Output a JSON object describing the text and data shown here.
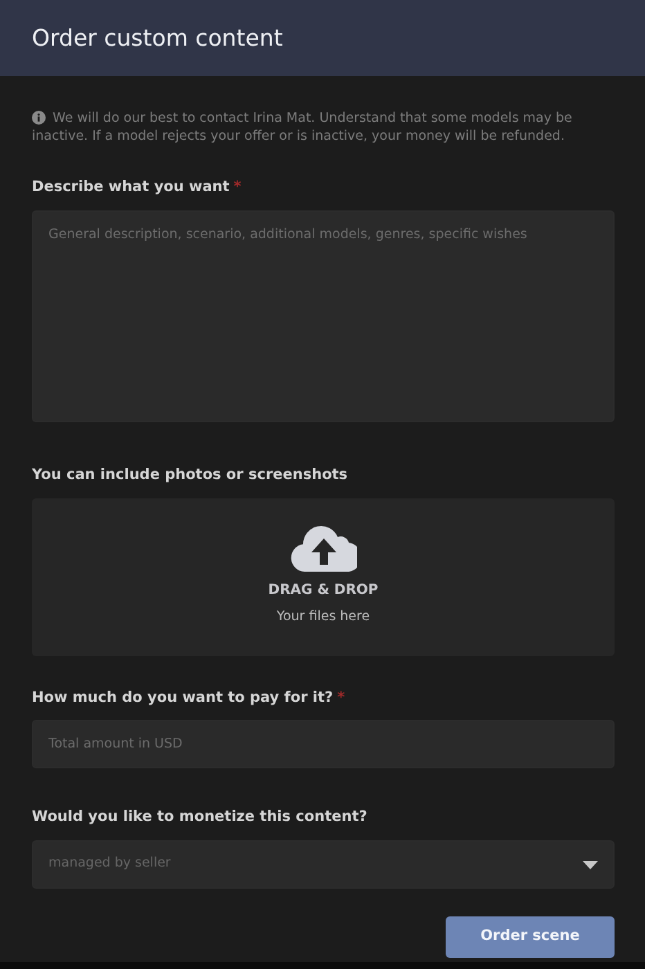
{
  "window": {
    "title": "Order custom content"
  },
  "notice": "We will do our best to contact Irina Mat. Understand that some models may be inactive. If a model rejects your offer or is inactive, your money will be refunded.",
  "fields": [
    {
      "kind": "textarea",
      "label": "Describe what you want",
      "required_mark": "*",
      "placeholder": "General description, scenario, additional models, genres, specific wishes"
    },
    {
      "kind": "dropzone",
      "label": "You can include photos or screenshots",
      "title": "DRAG & DROP",
      "subtitle": "Your files here"
    },
    {
      "kind": "input",
      "label": "How much do you want to pay for it?",
      "required_mark": "*",
      "placeholder": "Total amount in USD"
    },
    {
      "kind": "select",
      "label": "Would you like to monetize this content?",
      "value": "managed by seller"
    }
  ],
  "submit": "Order scene"
}
